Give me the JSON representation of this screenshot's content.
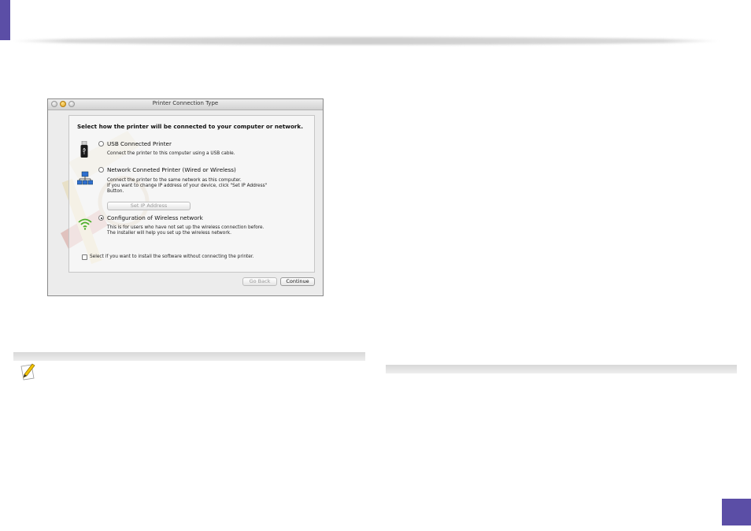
{
  "dialog": {
    "window_title": "Printer Connection Type",
    "heading": "Select how the printer will be connected to your computer or network.",
    "options": [
      {
        "label": "USB Connected Printer",
        "description": "Connect the printer to this computer using a USB cable.",
        "icon": "usb-icon",
        "selected": false
      },
      {
        "label": "Network Conneted Printer (Wired or Wireless)",
        "description": "Connect the printer to the same network as this computer.\nIf you want to change IP address of your device, click \"Set IP Address\"\nButton.",
        "icon": "network-icon",
        "selected": false
      },
      {
        "label": "Configuration of Wireless network",
        "description": "This is for users who have not set up the wireless connection before.\nThe installer will help you set up the wireless network.",
        "icon": "wifi-icon",
        "selected": true
      }
    ],
    "set_ip_button": "Set IP Address",
    "checkbox_label": "Select if you want to install the software without connecting the printer.",
    "checkbox_checked": false,
    "go_back_button": "Go Back",
    "continue_button": "Continue"
  },
  "colors": {
    "accent": "#5b4ea6",
    "wifi_green": "#4caf2a"
  },
  "icons": {
    "note": "note-pencil-icon"
  }
}
